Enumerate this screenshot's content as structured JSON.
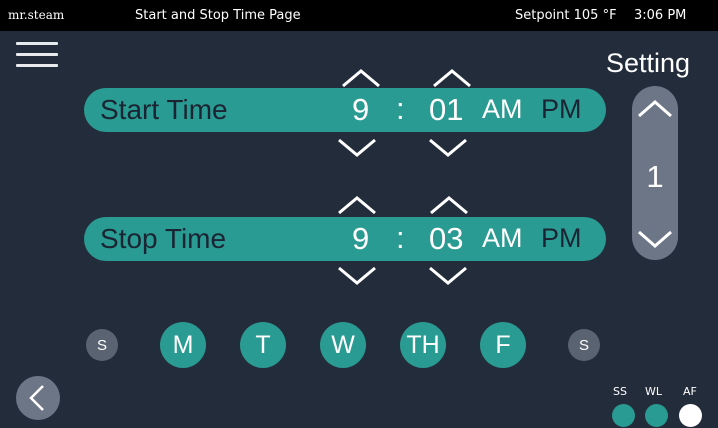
{
  "topbar": {
    "brand": "mr.steam",
    "title": "Start and Stop Time Page",
    "setpoint": "Setpoint 105 °F",
    "clock": "3:06 PM"
  },
  "menu_icon": "hamburger-menu-icon",
  "setting": {
    "title": "Setting",
    "value": "1"
  },
  "start": {
    "label": "Start Time",
    "hour": "9",
    "colon": ":",
    "minute": "01",
    "am": "AM",
    "pm": "PM",
    "selected_period": "AM"
  },
  "stop": {
    "label": "Stop Time",
    "hour": "9",
    "colon": ":",
    "minute": "03",
    "am": "AM",
    "pm": "PM",
    "selected_period": "AM"
  },
  "days": [
    {
      "label": "S",
      "active": false
    },
    {
      "label": "M",
      "active": true
    },
    {
      "label": "T",
      "active": true
    },
    {
      "label": "W",
      "active": true
    },
    {
      "label": "TH",
      "active": true
    },
    {
      "label": "F",
      "active": true
    },
    {
      "label": "S",
      "active": false
    }
  ],
  "indicators": [
    {
      "label": "SS",
      "color": "#2a9b92"
    },
    {
      "label": "WL",
      "color": "#2a9b92"
    },
    {
      "label": "AF",
      "color": "#ffffff"
    }
  ],
  "colors": {
    "accent": "#2a9b92",
    "background": "#232c3a",
    "topbar": "#000000",
    "inactive": "#5a6372"
  }
}
